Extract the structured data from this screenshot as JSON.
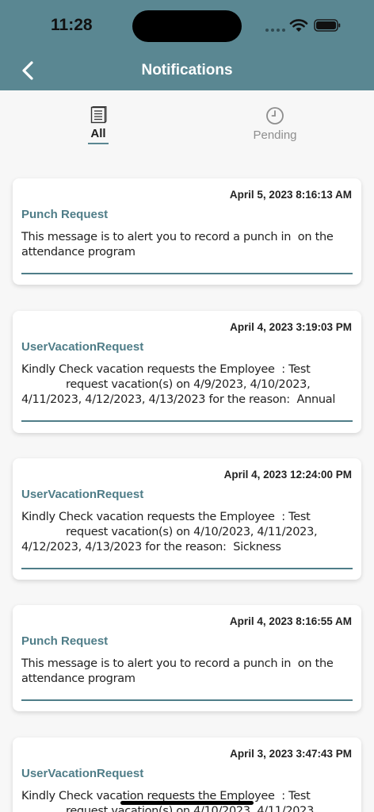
{
  "status_bar": {
    "time": "11:28"
  },
  "header": {
    "title": "Notifications"
  },
  "tabs": [
    {
      "label": "All",
      "icon": "list-icon",
      "active": true
    },
    {
      "label": "Pending",
      "icon": "clock-icon",
      "active": false
    }
  ],
  "notifications": [
    {
      "date": "April 5, 2023 8:16:13 AM",
      "title": "Punch Request",
      "body": "This message is to alert you to record a punch in  on the attendance program"
    },
    {
      "date": "April 4, 2023 3:19:03 PM",
      "title": "UserVacationRequest",
      "body": "Kindly Check vacation requests the Employee  : Test\n             request vacation(s) on 4/9/2023, 4/10/2023,\n4/11/2023, 4/12/2023, 4/13/2023 for the reason:  Annual"
    },
    {
      "date": "April 4, 2023 12:24:00 PM",
      "title": "UserVacationRequest",
      "body": "Kindly Check vacation requests the Employee  : Test\n             request vacation(s) on 4/10/2023, 4/11/2023,\n4/12/2023, 4/13/2023 for the reason:  Sickness"
    },
    {
      "date": "April 4, 2023 8:16:55 AM",
      "title": "Punch Request",
      "body": "This message is to alert you to record a punch in  on the attendance program"
    },
    {
      "date": "April 3, 2023 3:47:43 PM",
      "title": "UserVacationRequest",
      "body": "Kindly Check vacation requests the Employee  : Test\n             request vacation(s) on 4/10/2023, 4/11/2023"
    }
  ],
  "colors": {
    "header": "#5a8792",
    "accent": "#4f7d88"
  }
}
